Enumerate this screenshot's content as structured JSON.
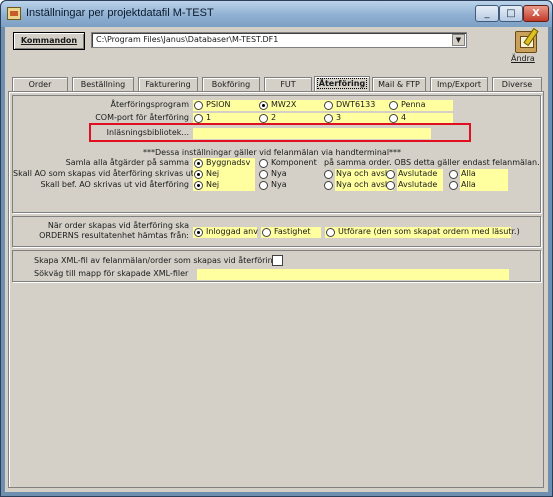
{
  "window": {
    "title": "Inställningar per projektdatafil  M-TEST",
    "min_glyph": "_",
    "max_glyph": "□",
    "close_glyph": "X"
  },
  "toolbar": {
    "command_label": "Kommandon",
    "path_value": "C:\\Program Files\\Janus\\Databaser\\M-TEST.DF1",
    "edit_label": "Ändra"
  },
  "tabs": [
    {
      "label": "Order"
    },
    {
      "label": "Beställning"
    },
    {
      "label": "Fakturering"
    },
    {
      "label": "Bokföring"
    },
    {
      "label": "FUT"
    },
    {
      "label": "Återföring"
    },
    {
      "label": "Mail & FTP"
    },
    {
      "label": "Imp/Export"
    },
    {
      "label": "Diverse"
    }
  ],
  "active_tab": "Återföring",
  "section1": {
    "program_label": "Återföringsprogram",
    "programs": [
      "PSION",
      "MW2X",
      "DWT6133",
      "Penna"
    ],
    "program_selected": "MW2X",
    "com_label": "COM-port för återföring",
    "com_ports": [
      "1",
      "2",
      "3",
      "4"
    ],
    "com_selected": "",
    "library_label": "Inläsningsbibliotek...",
    "library_value": "",
    "note": "***Dessa inställningar gäller vid felanmälan via handterminal***",
    "gather_label": "Samla alla åtgärder på samma",
    "gather_options": [
      "Byggnadsv",
      "Komponent"
    ],
    "gather_selected": "Byggnadsv",
    "gather_note": "på samma order. OBS detta gäller endast felanmälan.",
    "ao_label": "Skall AO som skapas vid återföring skrivas ut",
    "ao_options": [
      "Nej",
      "Nya",
      "Nya och avsl.",
      "Avslutade",
      "Alla"
    ],
    "ao_selected": "Nej",
    "existing_label": "Skall bef. AO skrivas ut vid återföring",
    "existing_options": [
      "Nej",
      "Nya",
      "Nya och avsl.",
      "Avslutade",
      "Alla"
    ],
    "existing_selected": "Nej"
  },
  "section2": {
    "label_line1": "När order skapas vid återföring ska",
    "label_line2": "ORDERNS resultatenhet hämtas från:",
    "options": [
      "Inloggad anv",
      "Fastighet",
      "Utförare (den som skapat ordern med läsutr.)"
    ],
    "selected": "Inloggad anv"
  },
  "section3": {
    "xml_label": "Skapa XML-fil av felanmälan/order som skapas vid återföring",
    "xml_checked": false,
    "folder_label": "Sökväg till mapp för skapade XML-filer",
    "folder_value": ""
  },
  "colors": {
    "field_yellow": "#ffffa0",
    "highlight_red": "#e01020",
    "panel_gray": "#d4d0c8"
  }
}
